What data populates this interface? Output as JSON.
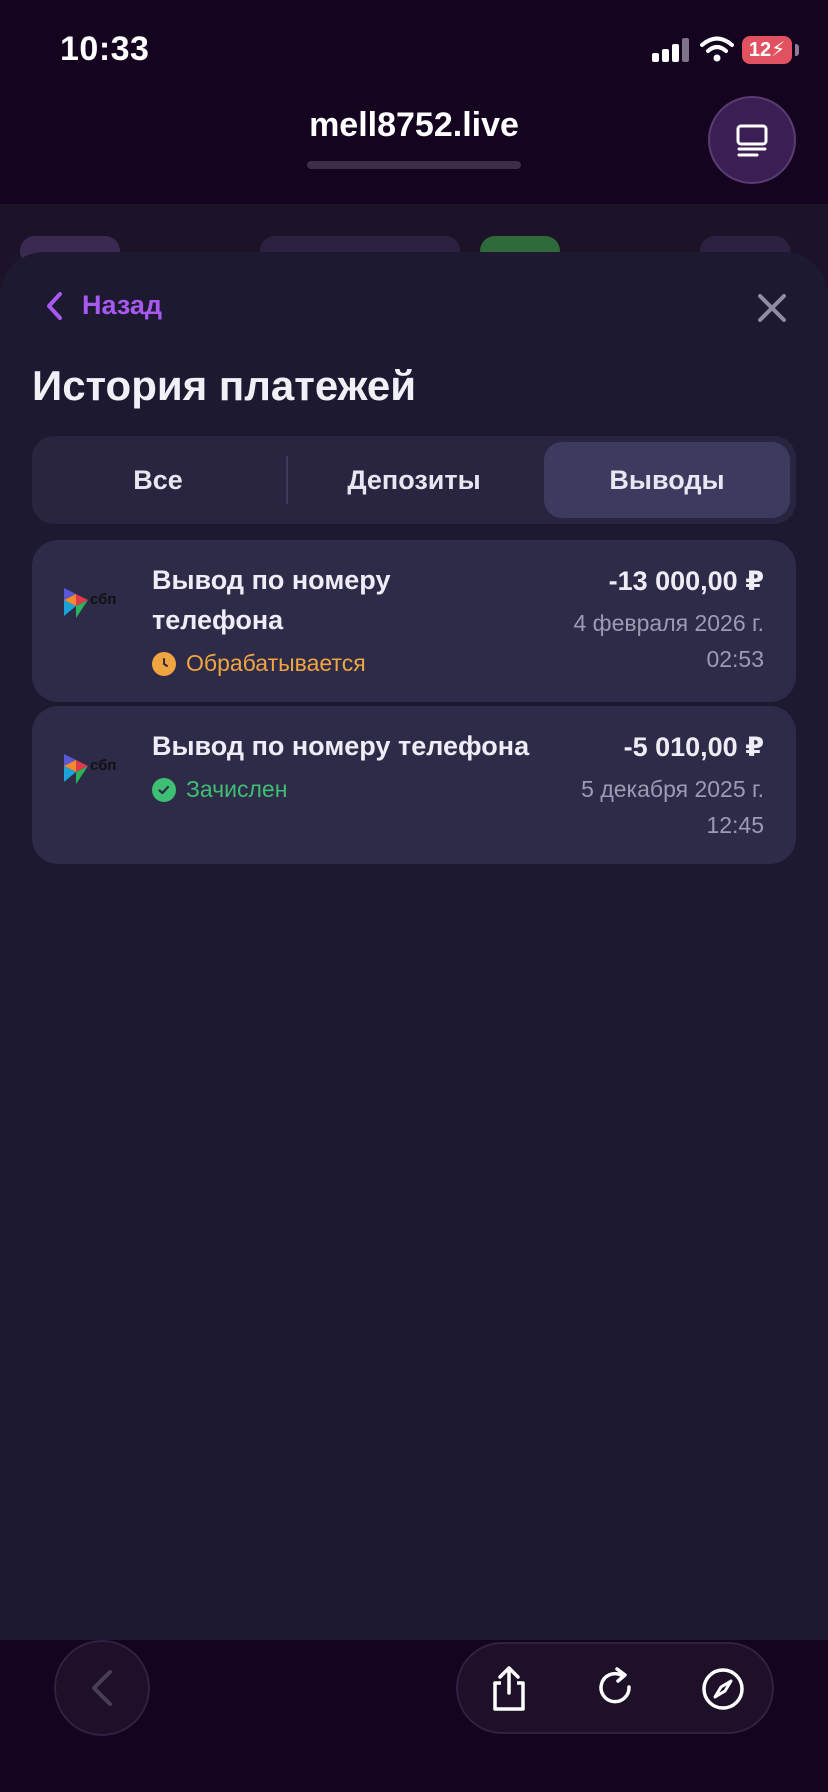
{
  "status_bar": {
    "time": "10:33",
    "battery": "12"
  },
  "browser": {
    "url": "mell8752.live"
  },
  "sheet": {
    "back_label": "Назад",
    "title": "История платежей",
    "tabs": [
      {
        "label": "Все",
        "active": false
      },
      {
        "label": "Депозиты",
        "active": false
      },
      {
        "label": "Выводы",
        "active": true
      }
    ],
    "transactions": [
      {
        "provider_logo": "сбп",
        "title_line1": "Вывод по номеру",
        "title_line2": "телефона",
        "status": "Обрабатывается",
        "status_icon": "clock-icon",
        "status_color": "#f0a540",
        "amount": "-13 000,00 ₽",
        "date": "4 февраля 2026 г.",
        "time": "02:53"
      },
      {
        "provider_logo": "сбп",
        "title_line1": "Вывод по номеру телефона",
        "title_line2": "",
        "status": "Зачислен",
        "status_icon": "check-icon",
        "status_color": "#3fbf73",
        "amount": "-5 010,00 ₽",
        "date": "5 декабря 2025 г.",
        "time": "12:45"
      }
    ]
  },
  "colors": {
    "accent": "#a759f0",
    "sheet_bg": "#1c1930",
    "card_bg": "#2d2b48",
    "active_tab": "#3c3a5e"
  }
}
